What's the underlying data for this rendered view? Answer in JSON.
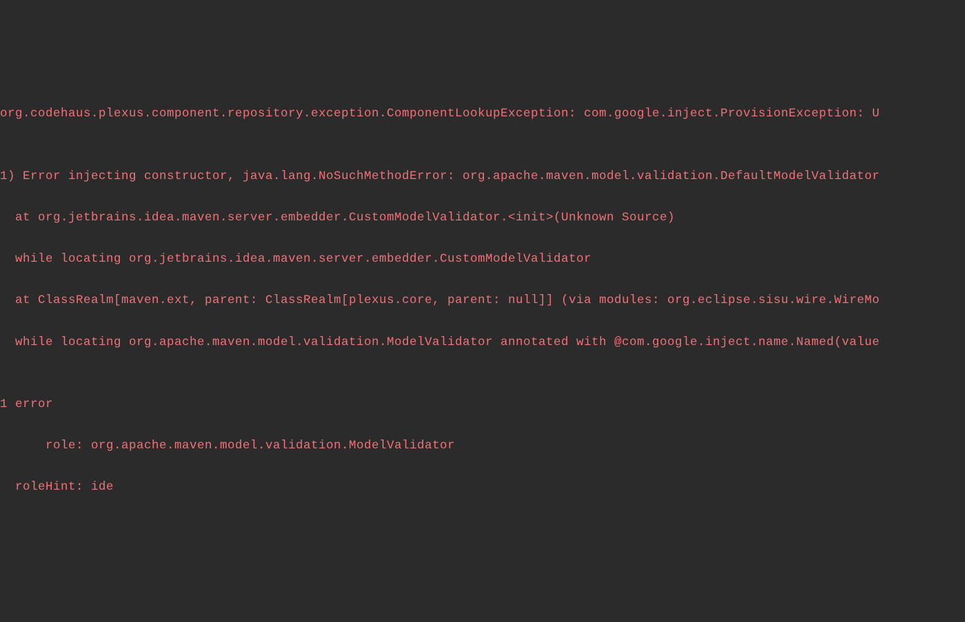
{
  "console": {
    "lines": [
      "org.codehaus.plexus.component.repository.exception.ComponentLookupException: com.google.inject.ProvisionException: U",
      "",
      "1) Error injecting constructor, java.lang.NoSuchMethodError: org.apache.maven.model.validation.DefaultModelValidator",
      "  at org.jetbrains.idea.maven.server.embedder.CustomModelValidator.<init>(Unknown Source)",
      "  while locating org.jetbrains.idea.maven.server.embedder.CustomModelValidator",
      "  at ClassRealm[maven.ext, parent: ClassRealm[plexus.core, parent: null]] (via modules: org.eclipse.sisu.wire.WireMo",
      "  while locating org.apache.maven.model.validation.ModelValidator annotated with @com.google.inject.name.Named(value",
      "",
      "1 error",
      "      role: org.apache.maven.model.validation.ModelValidator",
      "  roleHint: ide"
    ]
  }
}
